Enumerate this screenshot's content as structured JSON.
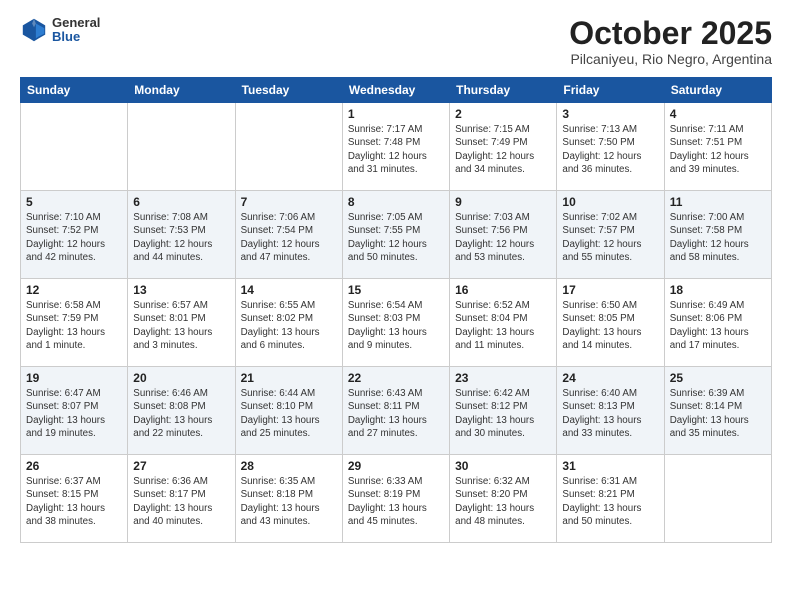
{
  "header": {
    "logo_general": "General",
    "logo_blue": "Blue",
    "title": "October 2025",
    "subtitle": "Pilcaniyeu, Rio Negro, Argentina"
  },
  "weekdays": [
    "Sunday",
    "Monday",
    "Tuesday",
    "Wednesday",
    "Thursday",
    "Friday",
    "Saturday"
  ],
  "weeks": [
    [
      {
        "day": "",
        "info": ""
      },
      {
        "day": "",
        "info": ""
      },
      {
        "day": "",
        "info": ""
      },
      {
        "day": "1",
        "info": "Sunrise: 7:17 AM\nSunset: 7:48 PM\nDaylight: 12 hours\nand 31 minutes."
      },
      {
        "day": "2",
        "info": "Sunrise: 7:15 AM\nSunset: 7:49 PM\nDaylight: 12 hours\nand 34 minutes."
      },
      {
        "day": "3",
        "info": "Sunrise: 7:13 AM\nSunset: 7:50 PM\nDaylight: 12 hours\nand 36 minutes."
      },
      {
        "day": "4",
        "info": "Sunrise: 7:11 AM\nSunset: 7:51 PM\nDaylight: 12 hours\nand 39 minutes."
      }
    ],
    [
      {
        "day": "5",
        "info": "Sunrise: 7:10 AM\nSunset: 7:52 PM\nDaylight: 12 hours\nand 42 minutes."
      },
      {
        "day": "6",
        "info": "Sunrise: 7:08 AM\nSunset: 7:53 PM\nDaylight: 12 hours\nand 44 minutes."
      },
      {
        "day": "7",
        "info": "Sunrise: 7:06 AM\nSunset: 7:54 PM\nDaylight: 12 hours\nand 47 minutes."
      },
      {
        "day": "8",
        "info": "Sunrise: 7:05 AM\nSunset: 7:55 PM\nDaylight: 12 hours\nand 50 minutes."
      },
      {
        "day": "9",
        "info": "Sunrise: 7:03 AM\nSunset: 7:56 PM\nDaylight: 12 hours\nand 53 minutes."
      },
      {
        "day": "10",
        "info": "Sunrise: 7:02 AM\nSunset: 7:57 PM\nDaylight: 12 hours\nand 55 minutes."
      },
      {
        "day": "11",
        "info": "Sunrise: 7:00 AM\nSunset: 7:58 PM\nDaylight: 12 hours\nand 58 minutes."
      }
    ],
    [
      {
        "day": "12",
        "info": "Sunrise: 6:58 AM\nSunset: 7:59 PM\nDaylight: 13 hours\nand 1 minute."
      },
      {
        "day": "13",
        "info": "Sunrise: 6:57 AM\nSunset: 8:01 PM\nDaylight: 13 hours\nand 3 minutes."
      },
      {
        "day": "14",
        "info": "Sunrise: 6:55 AM\nSunset: 8:02 PM\nDaylight: 13 hours\nand 6 minutes."
      },
      {
        "day": "15",
        "info": "Sunrise: 6:54 AM\nSunset: 8:03 PM\nDaylight: 13 hours\nand 9 minutes."
      },
      {
        "day": "16",
        "info": "Sunrise: 6:52 AM\nSunset: 8:04 PM\nDaylight: 13 hours\nand 11 minutes."
      },
      {
        "day": "17",
        "info": "Sunrise: 6:50 AM\nSunset: 8:05 PM\nDaylight: 13 hours\nand 14 minutes."
      },
      {
        "day": "18",
        "info": "Sunrise: 6:49 AM\nSunset: 8:06 PM\nDaylight: 13 hours\nand 17 minutes."
      }
    ],
    [
      {
        "day": "19",
        "info": "Sunrise: 6:47 AM\nSunset: 8:07 PM\nDaylight: 13 hours\nand 19 minutes."
      },
      {
        "day": "20",
        "info": "Sunrise: 6:46 AM\nSunset: 8:08 PM\nDaylight: 13 hours\nand 22 minutes."
      },
      {
        "day": "21",
        "info": "Sunrise: 6:44 AM\nSunset: 8:10 PM\nDaylight: 13 hours\nand 25 minutes."
      },
      {
        "day": "22",
        "info": "Sunrise: 6:43 AM\nSunset: 8:11 PM\nDaylight: 13 hours\nand 27 minutes."
      },
      {
        "day": "23",
        "info": "Sunrise: 6:42 AM\nSunset: 8:12 PM\nDaylight: 13 hours\nand 30 minutes."
      },
      {
        "day": "24",
        "info": "Sunrise: 6:40 AM\nSunset: 8:13 PM\nDaylight: 13 hours\nand 33 minutes."
      },
      {
        "day": "25",
        "info": "Sunrise: 6:39 AM\nSunset: 8:14 PM\nDaylight: 13 hours\nand 35 minutes."
      }
    ],
    [
      {
        "day": "26",
        "info": "Sunrise: 6:37 AM\nSunset: 8:15 PM\nDaylight: 13 hours\nand 38 minutes."
      },
      {
        "day": "27",
        "info": "Sunrise: 6:36 AM\nSunset: 8:17 PM\nDaylight: 13 hours\nand 40 minutes."
      },
      {
        "day": "28",
        "info": "Sunrise: 6:35 AM\nSunset: 8:18 PM\nDaylight: 13 hours\nand 43 minutes."
      },
      {
        "day": "29",
        "info": "Sunrise: 6:33 AM\nSunset: 8:19 PM\nDaylight: 13 hours\nand 45 minutes."
      },
      {
        "day": "30",
        "info": "Sunrise: 6:32 AM\nSunset: 8:20 PM\nDaylight: 13 hours\nand 48 minutes."
      },
      {
        "day": "31",
        "info": "Sunrise: 6:31 AM\nSunset: 8:21 PM\nDaylight: 13 hours\nand 50 minutes."
      },
      {
        "day": "",
        "info": ""
      }
    ]
  ]
}
